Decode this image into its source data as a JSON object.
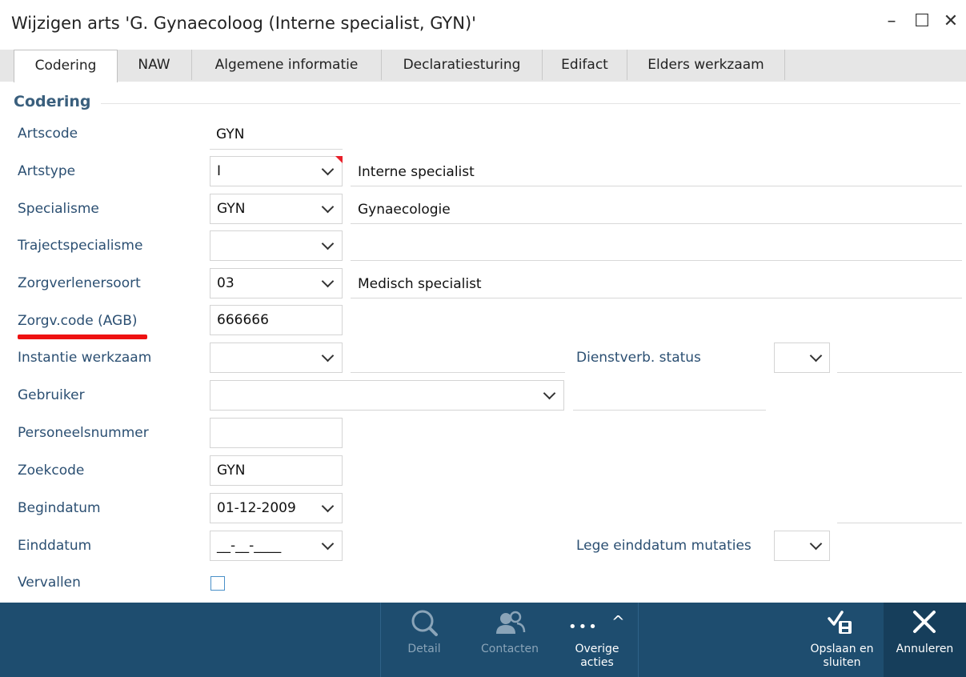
{
  "window": {
    "title": "Wijzigen arts 'G. Gynaecoloog (Interne specialist, GYN)'",
    "controls": {
      "minimize": "–",
      "maximize": "☐",
      "close": "✕"
    }
  },
  "tabs": [
    {
      "label": "Codering",
      "active": true
    },
    {
      "label": "NAW"
    },
    {
      "label": "Algemene informatie"
    },
    {
      "label": "Declaratiesturing"
    },
    {
      "label": "Edifact"
    },
    {
      "label": "Elders werkzaam"
    }
  ],
  "section": {
    "title": "Codering"
  },
  "fields": {
    "artscode": {
      "label": "Artscode",
      "value": "GYN"
    },
    "artstype": {
      "label": "Artstype",
      "value": "I",
      "description": "Interne specialist"
    },
    "specialisme": {
      "label": "Specialisme",
      "value": "GYN",
      "description": "Gynaecologie"
    },
    "trajectspecialisme": {
      "label": "Trajectspecialisme",
      "value": "",
      "description": ""
    },
    "zorgverlenersoort": {
      "label": "Zorgverlenersoort",
      "value": "03",
      "description": "Medisch specialist"
    },
    "zorgv_code": {
      "label": "Zorgv.code (AGB)",
      "value": "666666"
    },
    "instantie_werkzaam": {
      "label": "Instantie werkzaam",
      "value": "",
      "description": ""
    },
    "dienstverb_status": {
      "label": "Dienstverb. status",
      "value": "",
      "description": ""
    },
    "gebruiker": {
      "label": "Gebruiker",
      "value": "",
      "description": ""
    },
    "personeelsnummer": {
      "label": "Personeelsnummer",
      "value": ""
    },
    "zoekcode": {
      "label": "Zoekcode",
      "value": "GYN"
    },
    "begindatum": {
      "label": "Begindatum",
      "value": "01-12-2009"
    },
    "einddatum": {
      "label": "Einddatum",
      "value": "__-__-____"
    },
    "lege_einddatum_mutaties": {
      "label": "Lege einddatum mutaties",
      "value": ""
    },
    "vervallen": {
      "label": "Vervallen",
      "checked": false
    }
  },
  "toolbar": {
    "detail": {
      "label": "Detail",
      "enabled": false
    },
    "contacten": {
      "label": "Contacten",
      "enabled": false
    },
    "overige": {
      "label": "Overige acties",
      "dots": "•••",
      "caret": "^"
    },
    "opslaan": {
      "label": "Opslaan en sluiten"
    },
    "annuleren": {
      "label": "Annuleren"
    }
  },
  "colors": {
    "label": "#2b4f72",
    "section_title": "#3a5f7d",
    "footer": "#1e4d6f",
    "highlight_underline": "#ee1111",
    "checkbox_border": "#4a90c8"
  }
}
